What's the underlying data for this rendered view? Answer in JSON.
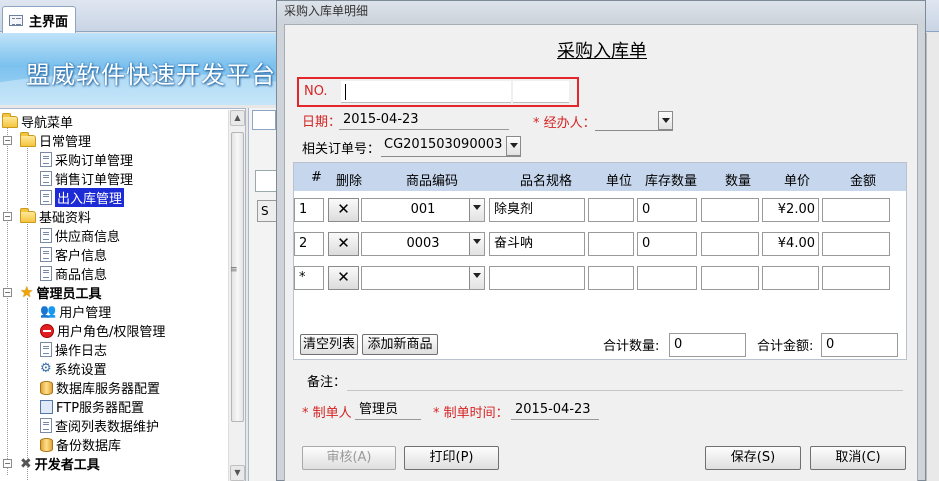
{
  "main": {
    "tab_title": "主界面",
    "banner_title": "盟威软件快速开发平台",
    "nav": {
      "root": "导航菜单",
      "daily": "日常管理",
      "purchase_orders": "采购订单管理",
      "sales_orders": "销售订单管理",
      "stock_io": "出入库管理",
      "basic": "基础资料",
      "suppliers": "供应商信息",
      "customers": "客户信息",
      "products": "商品信息",
      "admin_tools": "管理员工具",
      "user_mgmt": "用户管理",
      "roles": "用户角色/权限管理",
      "op_log": "操作日志",
      "sys_settings": "系统设置",
      "db_server": "数据库服务器配置",
      "ftp_server": "FTP服务器配置",
      "list_maint": "查阅列表数据维护",
      "backup": "备份数据库",
      "dev_tools": "开发者工具"
    },
    "right_pane_button": "S"
  },
  "dialog": {
    "window_title": "采购入库单明细",
    "form_title": "采购入库单",
    "no_label": "NO.",
    "date_label": "日期：",
    "date_value": "2015-04-23",
    "handler_label": "* 经办人：",
    "handler_value": "",
    "order_label": "相关订单号：",
    "order_value": "CG201503090003",
    "grid": {
      "headers": [
        "#",
        "删除",
        "商品编码",
        "品名规格",
        "单位",
        "库存数量",
        "数量",
        "单价",
        "金额"
      ],
      "rows": [
        {
          "num": "1",
          "code": "001",
          "name": "除臭剂",
          "unit": "",
          "stock": "0",
          "qty": "",
          "price": "¥2.00",
          "amount": ""
        },
        {
          "num": "2",
          "code": "0003",
          "name": "奋斗呐",
          "unit": "",
          "stock": "0",
          "qty": "",
          "price": "¥4.00",
          "amount": ""
        },
        {
          "num": "*",
          "code": "",
          "name": "",
          "unit": "",
          "stock": "",
          "qty": "",
          "price": "",
          "amount": ""
        }
      ],
      "delete_glyph": "✕"
    },
    "clear_button": "清空列表",
    "add_button": "添加新商品",
    "total_qty_label": "合计数量:",
    "total_qty_value": "0",
    "total_amount_label": "合计金额:",
    "total_amount_value": "0",
    "remark_label": "备注：",
    "maker_label": "* 制单人",
    "maker_value": "管理员",
    "make_time_label": "* 制单时间：",
    "make_time_value": "2015-04-23",
    "buttons": {
      "audit": "审核(A)",
      "print": "打印(P)",
      "save": "保存(S)",
      "cancel": "取消(C)"
    },
    "colors": {
      "required": "#d42424",
      "highlight_border": "#e4252a",
      "grid_header": "#c6d6ec"
    }
  }
}
